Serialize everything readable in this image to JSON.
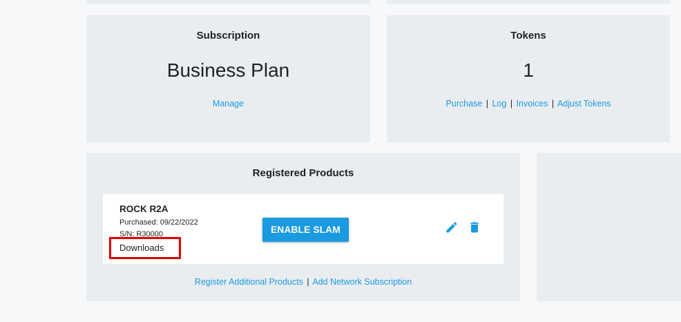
{
  "subscription": {
    "title": "Subscription",
    "plan": "Business Plan",
    "manage_label": "Manage"
  },
  "tokens": {
    "title": "Tokens",
    "count": "1",
    "links": {
      "purchase": "Purchase",
      "log": "Log",
      "invoices": "Invoices",
      "adjust": "Adjust Tokens"
    },
    "separator": "|"
  },
  "registered_products": {
    "title": "Registered Products",
    "product": {
      "name": "ROCK R2A",
      "purchased": "Purchased: 09/22/2022",
      "serial": "S/N: R30000",
      "downloads_label": "Downloads",
      "enable_button": "ENABLE SLAM",
      "edit_icon": "pencil-icon",
      "delete_icon": "trash-icon"
    },
    "footer_links": {
      "register": "Register Additional Products",
      "network": "Add Network Subscription"
    },
    "separator": "|"
  },
  "colors": {
    "accent": "#1a9ae0",
    "card_bg": "#eaedf0",
    "page_bg": "#f7f8fa",
    "highlight": "#e00000"
  }
}
